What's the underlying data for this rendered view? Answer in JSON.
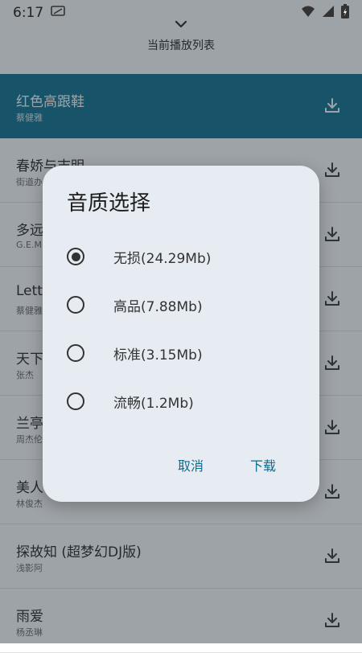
{
  "status_bar": {
    "time": "6:17"
  },
  "header": {
    "title": "当前播放列表"
  },
  "songs": [
    {
      "title": "红色高跟鞋",
      "artist": "蔡健雅"
    },
    {
      "title": "春娇与志明",
      "artist": "街道办"
    },
    {
      "title": "多远",
      "artist": "G.E.M"
    },
    {
      "title": "Letti",
      "artist": "蔡健雅"
    },
    {
      "title": "天下",
      "artist": "张杰"
    },
    {
      "title": "兰亭",
      "artist": "周杰伦"
    },
    {
      "title": "美人",
      "artist": "林俊杰"
    },
    {
      "title": "探故知 (超梦幻DJ版)",
      "artist": "浅影阿"
    },
    {
      "title": "雨爱",
      "artist": "杨丞琳"
    }
  ],
  "dialog": {
    "title": "音质选择",
    "options": [
      {
        "label": "无损(24.29Mb)",
        "selected": true
      },
      {
        "label": "高品(7.88Mb)",
        "selected": false
      },
      {
        "label": "标准(3.15Mb)",
        "selected": false
      },
      {
        "label": "流畅(1.2Mb)",
        "selected": false
      }
    ],
    "cancel_label": "取消",
    "confirm_label": "下载"
  },
  "colors": {
    "accent": "#0a6d8f",
    "dialog_bg": "#e6ecf2",
    "scrim": "rgba(40,50,60,0.45)"
  }
}
